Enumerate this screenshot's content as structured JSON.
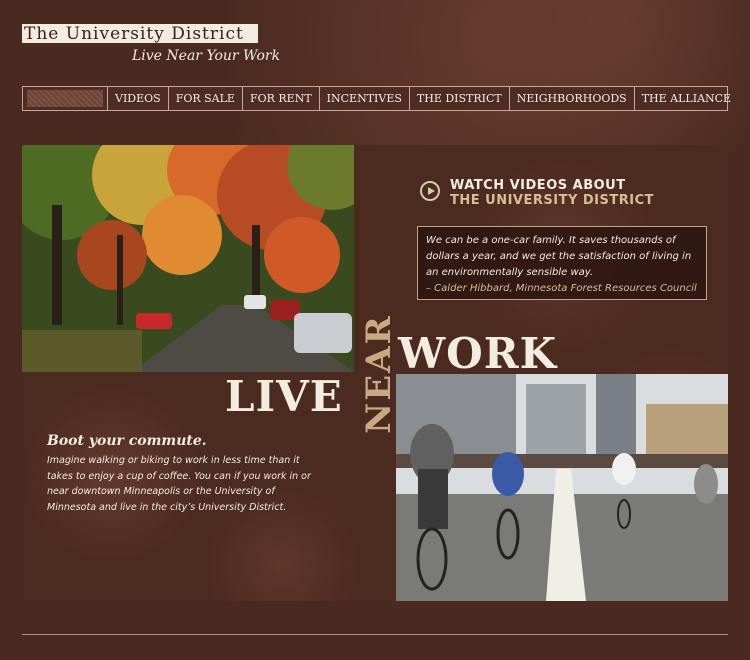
{
  "logo": {
    "name": "The University District",
    "tagline": "Live Near Your Work"
  },
  "nav": {
    "items": [
      {
        "label": "VIDEOS"
      },
      {
        "label": "FOR SALE"
      },
      {
        "label": "FOR RENT"
      },
      {
        "label": "INCENTIVES"
      },
      {
        "label": "THE DISTRICT"
      },
      {
        "label": "NEIGHBORHOODS"
      },
      {
        "label": "THE ALLIANCE"
      }
    ]
  },
  "videos": {
    "line1": "WATCH VIDEOS ABOUT",
    "line2": "THE UNIVERSITY DISTRICT"
  },
  "quote": {
    "text": "We can be a one-car family. It saves thousands of dollars a year, and we get the satisfaction of living in an environmentally sensible way.",
    "attribution": "– Calder Hibbard, Minnesota Forest Resources Council"
  },
  "headline": {
    "live": "LIVE",
    "near": "NEAR",
    "work": "WORK"
  },
  "boot": {
    "title": "Boot your commute.",
    "body": "Imagine walking or biking to work in less time than it takes to enjoy a cup of coffee. You can if you work in or near downtown Minneapolis or the University of Minnesota and live in the city’s University District."
  },
  "colors": {
    "background": "#4a2a20",
    "cream": "#f3ece0",
    "accent": "#d6bf90"
  }
}
